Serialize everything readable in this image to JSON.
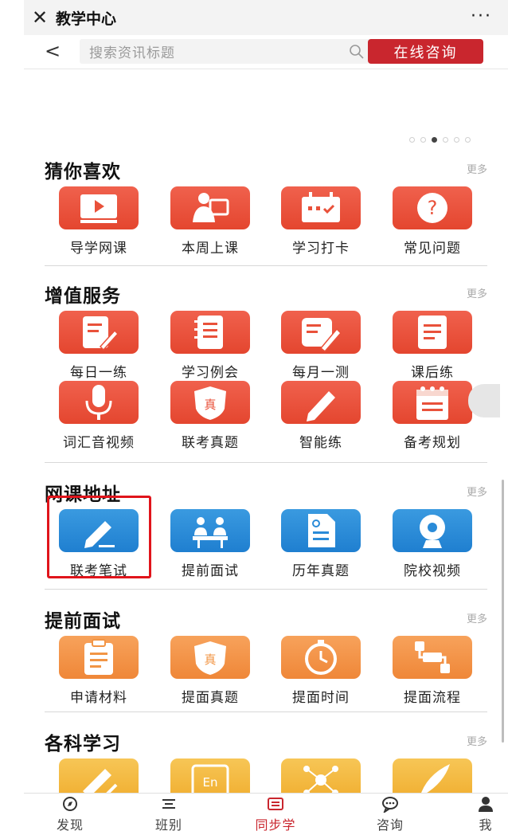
{
  "titlebar": {
    "close_glyph": "✕",
    "title": "教学中心",
    "more_glyph": "···"
  },
  "search": {
    "back_glyph": "<",
    "placeholder": "搜索资讯标题",
    "consult_button": "在线咨询"
  },
  "banner": {
    "dot_count": 6,
    "active_dot": 2
  },
  "sections": [
    {
      "title": "猜你喜欢",
      "more": "更多",
      "items": [
        {
          "label": "导学网课",
          "icon": "play-icon",
          "color": "red"
        },
        {
          "label": "本周上课",
          "icon": "teacher-icon",
          "color": "red"
        },
        {
          "label": "学习打卡",
          "icon": "calendar-icon",
          "color": "red"
        },
        {
          "label": "常见问题",
          "icon": "question-icon",
          "color": "red"
        }
      ]
    },
    {
      "title": "增值服务",
      "more": "更多",
      "items": [
        {
          "label": "每日一练",
          "icon": "write-icon",
          "color": "red"
        },
        {
          "label": "学习例会",
          "icon": "notebook-icon",
          "color": "red"
        },
        {
          "label": "每月一测",
          "icon": "test-icon",
          "color": "red"
        },
        {
          "label": "课后练",
          "icon": "document-icon",
          "color": "red"
        },
        {
          "label": "词汇音视频",
          "icon": "microphone-icon",
          "color": "red"
        },
        {
          "label": "联考真题",
          "icon": "shield-icon",
          "color": "red",
          "badge": "真"
        },
        {
          "label": "智能练",
          "icon": "pencil-icon",
          "color": "red"
        },
        {
          "label": "备考规划",
          "icon": "planner-icon",
          "color": "red"
        }
      ]
    },
    {
      "title": "网课地址",
      "more": "更多",
      "items": [
        {
          "label": "联考笔试",
          "icon": "pen-icon",
          "color": "blue",
          "highlighted": true
        },
        {
          "label": "提前面试",
          "icon": "interview-icon",
          "color": "blue"
        },
        {
          "label": "历年真题",
          "icon": "file-icon",
          "color": "blue"
        },
        {
          "label": "院校视频",
          "icon": "camera-icon",
          "color": "blue"
        }
      ]
    },
    {
      "title": "提前面试",
      "more": "更多",
      "items": [
        {
          "label": "申请材料",
          "icon": "clipboard-icon",
          "color": "orange"
        },
        {
          "label": "提面真题",
          "icon": "shield-icon",
          "color": "orange",
          "badge": "真"
        },
        {
          "label": "提面时间",
          "icon": "timer-icon",
          "color": "orange"
        },
        {
          "label": "提面流程",
          "icon": "flow-icon",
          "color": "orange"
        }
      ]
    },
    {
      "title": "各科学习",
      "more": "更多",
      "items": [
        {
          "label": "",
          "icon": "ruler-icon",
          "color": "yellow"
        },
        {
          "label": "",
          "icon": "english-icon",
          "color": "yellow",
          "badge": "En"
        },
        {
          "label": "",
          "icon": "network-icon",
          "color": "yellow"
        },
        {
          "label": "",
          "icon": "quill-icon",
          "color": "yellow"
        }
      ]
    }
  ],
  "tabbar": [
    {
      "label": "发现",
      "icon": "compass-icon",
      "active": false
    },
    {
      "label": "班别",
      "icon": "list-icon",
      "active": false
    },
    {
      "label": "同步学",
      "icon": "book-icon",
      "active": true
    },
    {
      "label": "咨询",
      "icon": "chat-icon",
      "active": false
    },
    {
      "label": "我",
      "icon": "user-icon",
      "active": false
    }
  ],
  "colors": {
    "brand_red": "#c9262e",
    "icon_red": "#e9513a",
    "icon_blue": "#2a8bd8",
    "icon_orange": "#f29545",
    "icon_yellow": "#f3b940"
  }
}
